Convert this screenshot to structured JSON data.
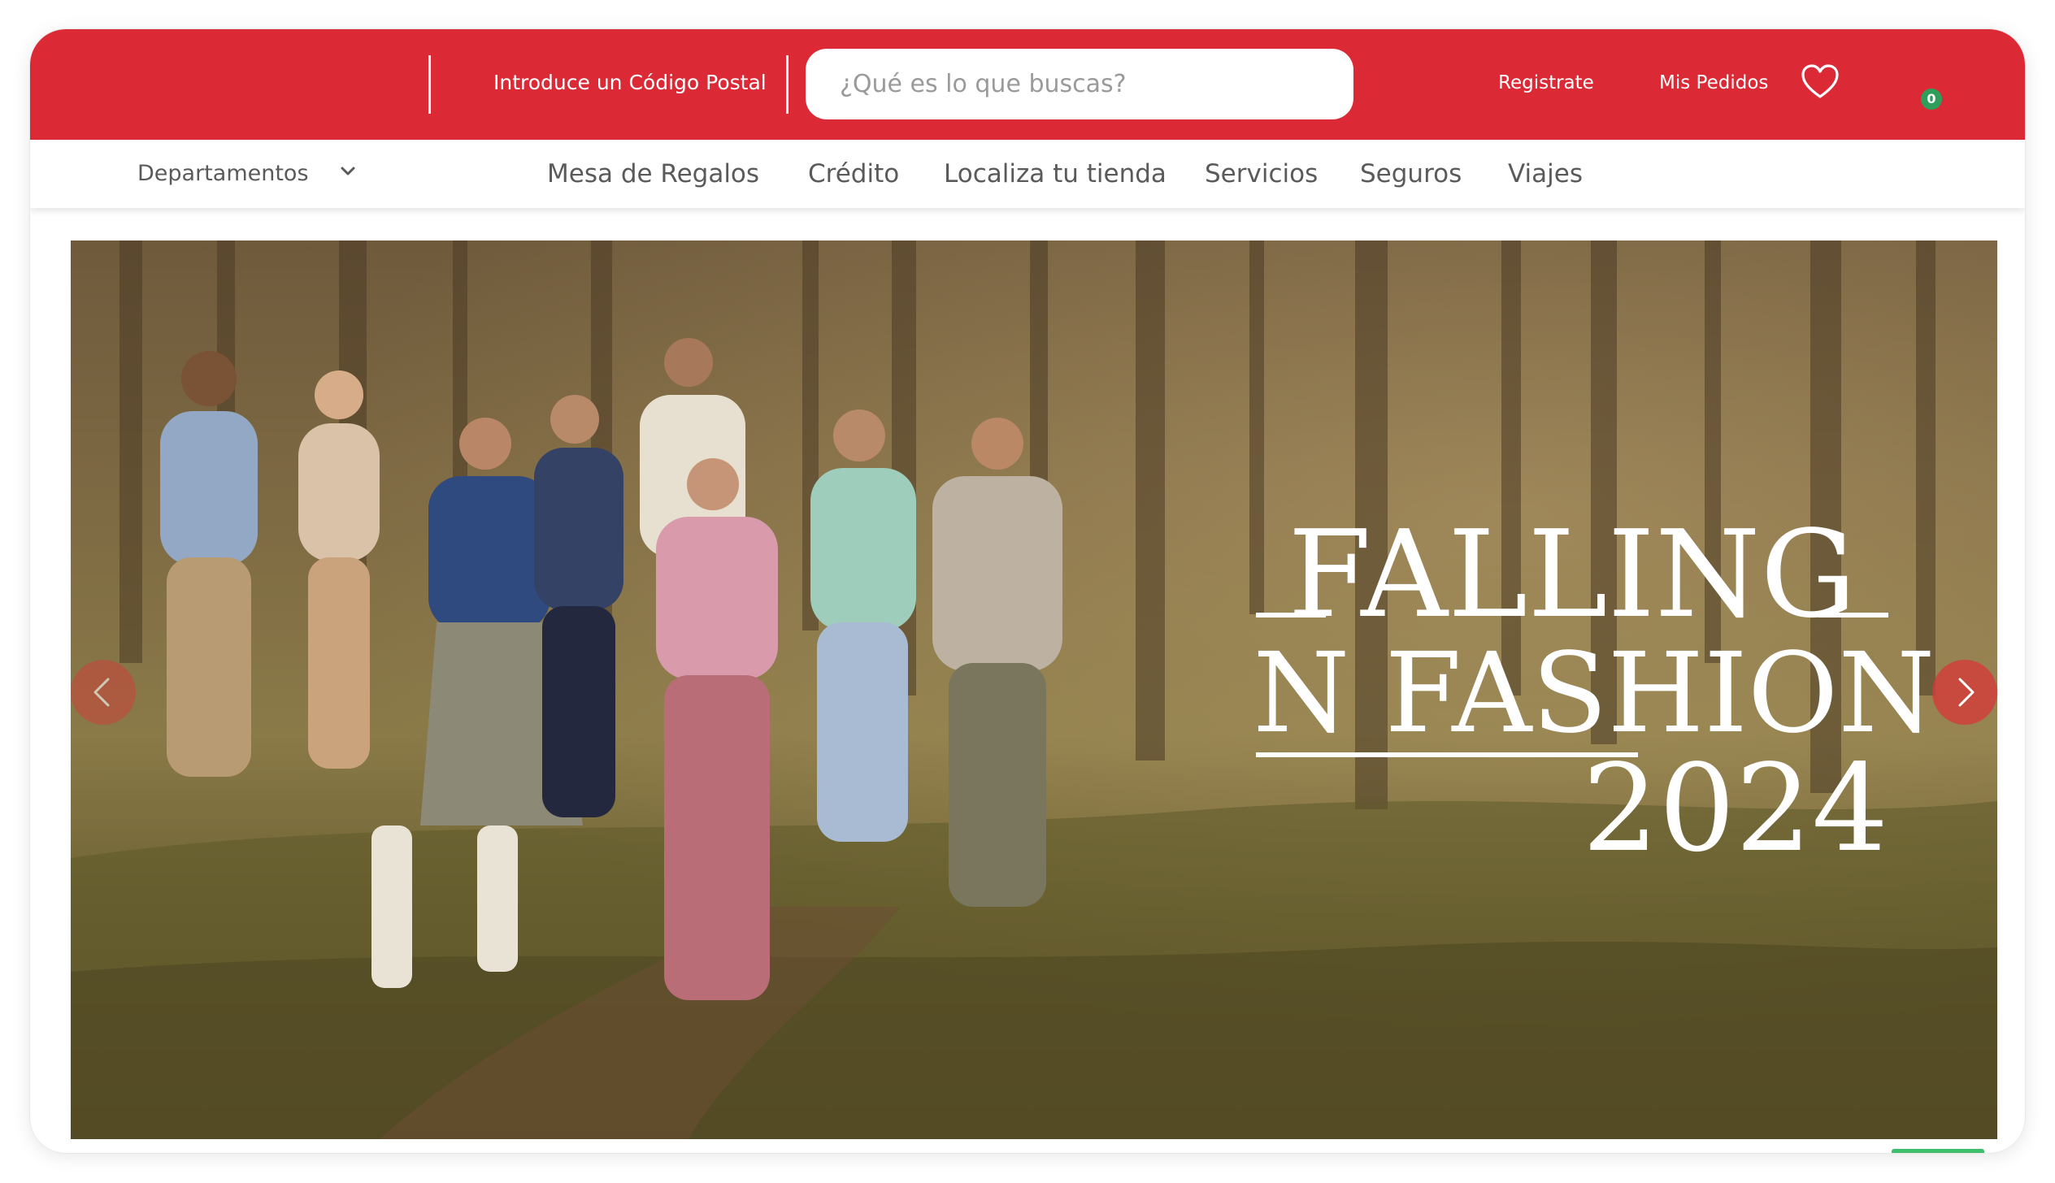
{
  "header": {
    "postal_code_label": "Introduce un Código Postal",
    "search_placeholder": "¿Qué es lo que buscas?",
    "register_label": "Registrate",
    "orders_label": "Mis Pedidos",
    "cart_count": "0",
    "icons": [
      "heart-icon",
      "cart-icon"
    ],
    "brand_color": "#db2a36",
    "badge_color": "#2e9e5b"
  },
  "nav": {
    "departments_label": "Departamentos",
    "links": [
      {
        "label": "Mesa de Regalos"
      },
      {
        "label": "Crédito"
      },
      {
        "label": "Localiza tu tienda"
      },
      {
        "label": "Servicios"
      },
      {
        "label": "Seguros"
      },
      {
        "label": "Viajes"
      }
    ]
  },
  "hero": {
    "line1": "FALLING",
    "line2": "IN FASHION",
    "line3": "2024",
    "icons": [
      "chevron-left-icon",
      "chevron-right-icon"
    ]
  }
}
